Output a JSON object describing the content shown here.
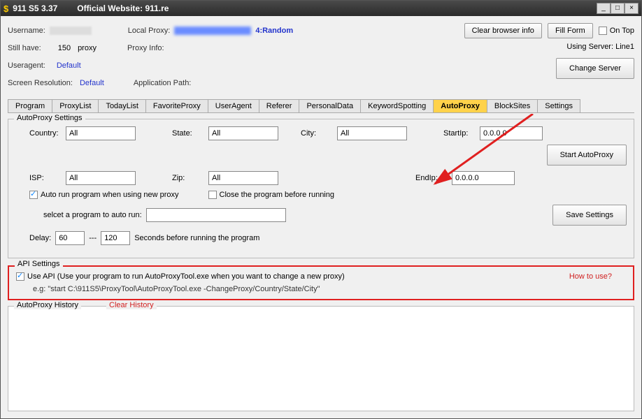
{
  "titlebar": {
    "app_name": "911 S5 3.37",
    "website_label": "Official Website:",
    "website": "911.re"
  },
  "header": {
    "username_label": "Username:",
    "local_proxy_label": "Local Proxy:",
    "local_proxy_suffix": "4:Random",
    "still_have_label": "Still have:",
    "still_have_count": "150",
    "still_have_unit": "proxy",
    "proxy_info_label": "Proxy Info:",
    "useragent_label": "Useragent:",
    "useragent_value": "Default",
    "screen_res_label": "Screen Resolution:",
    "screen_res_value": "Default",
    "app_path_label": "Application Path:",
    "clear_browser_btn": "Clear browser info",
    "fill_form_btn": "Fill Form",
    "on_top_label": "On Top",
    "using_server": "Using Server: Line1",
    "change_server_btn": "Change Server"
  },
  "tabs": [
    "Program",
    "ProxyList",
    "TodayList",
    "FavoriteProxy",
    "UserAgent",
    "Referer",
    "PersonalData",
    "KeywordSpotting",
    "AutoProxy",
    "BlockSites",
    "Settings"
  ],
  "active_tab": "AutoProxy",
  "autoproxy": {
    "group_title": "AutoProxy Settings",
    "country_label": "Country:",
    "country_value": "All",
    "state_label": "State:",
    "state_value": "All",
    "city_label": "City:",
    "city_value": "All",
    "startip_label": "StartIp:",
    "startip_value": "0.0.0.0",
    "isp_label": "ISP:",
    "isp_value": "All",
    "zip_label": "Zip:",
    "zip_value": "All",
    "endip_label": "EndIp:",
    "endip_value": "0.0.0.0",
    "auto_run_label": "Auto run program when using new proxy",
    "close_before_label": "Close the program before running",
    "select_program_label": "selcet a program to auto run:",
    "delay_label": "Delay:",
    "delay_min": "60",
    "delay_max": "120",
    "delay_suffix": "Seconds before running the program",
    "start_btn": "Start AutoProxy",
    "save_btn": "Save Settings"
  },
  "api": {
    "group_title": "API Settings",
    "use_api_label": "Use API (Use your program to run AutoProxyTool.exe when you want to change a new proxy)",
    "example": "e.g: \"start C:\\911S5\\ProxyTool\\AutoProxyTool.exe -ChangeProxy/Country/State/City\"",
    "how_to_use": "How to use?"
  },
  "history": {
    "title": "AutoProxy History",
    "clear": "Clear History"
  }
}
